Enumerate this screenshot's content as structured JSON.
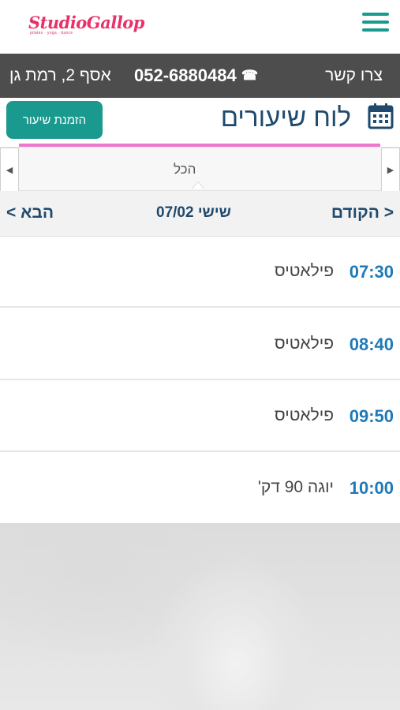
{
  "header": {
    "logo_text": "StudioGallop",
    "logo_subtext": "pilates · yoga · dance",
    "menu_icon": "hamburger-icon",
    "accent_color": "#1a9a8e"
  },
  "contact": {
    "contact_label": "צרו קשר",
    "phone": "052-6880484",
    "address": "אסף 2, רמת גן"
  },
  "title_row": {
    "title": "לוח שיעורים",
    "book_button": "הזמנת שיעור",
    "calendar_icon": "calendar-icon"
  },
  "filter": {
    "current": "הכל",
    "accent_color": "#ee77cc"
  },
  "date_nav": {
    "prev_label": "הקודם",
    "next_label": "הבא",
    "date_label": "שישי 07/02"
  },
  "classes": [
    {
      "time": "07:30",
      "name": "פילאטיס"
    },
    {
      "time": "08:40",
      "name": "פילאטיס"
    },
    {
      "time": "09:50",
      "name": "פילאטיס"
    },
    {
      "time": "10:00",
      "name": "יוגה 90 דק'"
    }
  ]
}
